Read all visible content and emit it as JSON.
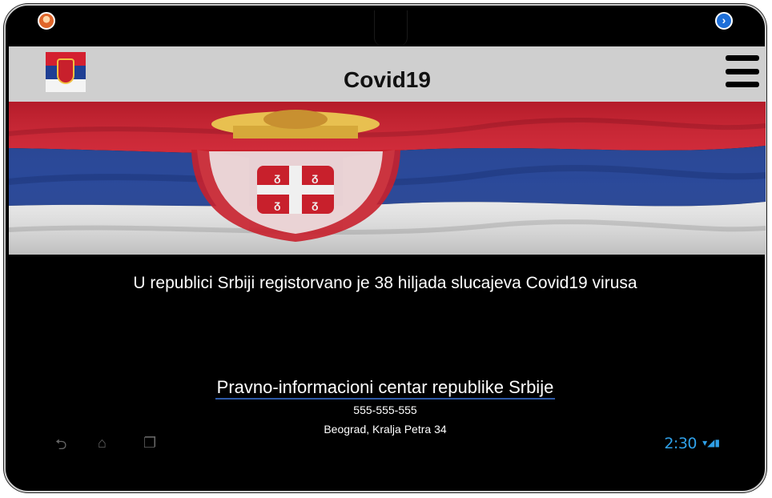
{
  "app": {
    "title": "Covid19"
  },
  "icons": {
    "left_status": "user-avatar-icon",
    "right_status": "arrow-right-circle-icon",
    "menu": "hamburger-menu-icon",
    "flag": "serbia-flag-icon"
  },
  "colors": {
    "appbar_bg": "#cfcfcf",
    "screen_bg": "#000000",
    "link_underline": "#2e5aa8",
    "clock": "#2fa0e8",
    "flag_red": "#d42030",
    "flag_blue": "#1f3f94",
    "flag_white": "#f4f4f4"
  },
  "main": {
    "headline": "U republici Srbiji registorvano je 38 hiljada slucajeva Covid19 virusa",
    "org_link": "Pravno-informacioni centar republike Srbije",
    "phone": "555-555-555",
    "address": "Beograd, Kralja Petra 34"
  },
  "system": {
    "time": "2:30",
    "nav_back": "⮌",
    "nav_home": "⌂",
    "nav_recent": "❐",
    "status_icons": "▾◢▮"
  }
}
